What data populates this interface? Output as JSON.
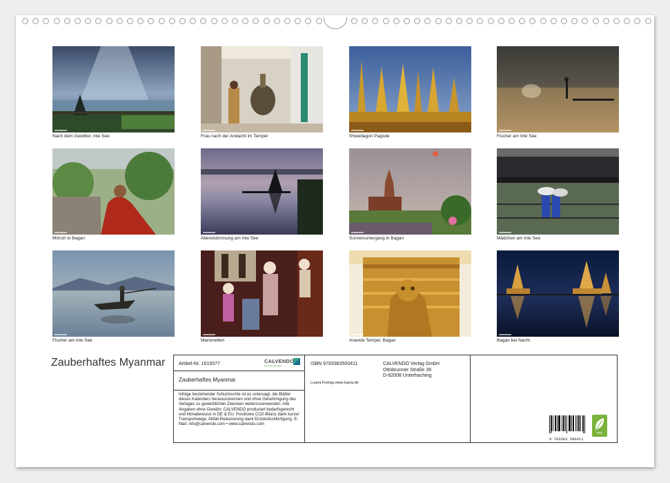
{
  "photos": [
    {
      "caption": "Nach dem Gewitter, Inle See"
    },
    {
      "caption": "Frau nach der Andacht im Tempel"
    },
    {
      "caption": "Shwedagon Pagode"
    },
    {
      "caption": "Fischer am Inle See"
    },
    {
      "caption": "Mönch in Bagan"
    },
    {
      "caption": "Abendstimmung am Inle See"
    },
    {
      "caption": "Sonnenuntergang in Bagan"
    },
    {
      "caption": "Mädchen am Inle See"
    },
    {
      "caption": "Fischer am Inle See"
    },
    {
      "caption": "Marionetten"
    },
    {
      "caption": "Ananda Tempel, Bagan"
    },
    {
      "caption": "Bagan bei Nacht"
    }
  ],
  "title": "Zauberhaftes Myanmar",
  "info": {
    "article_no": "Artikel-Nr. 1615577",
    "logo": "CALVENDO",
    "logo_sub": "Die Kalendermarke",
    "box_title": "Zauberhaftes Myanmar",
    "legal_text": "Infolge bestehender Schutzrechte ist es untersagt, die Blätter dieses Kalenders herauszutrennen und ohne Genehmigung des Verlages zu gewerblichen Zwecken weiterzuverwenden. Alle Angaben ohne Gewähr. CALVENDO produziert bedarfsgerecht und klimabewusst in DE & EU. Positivere CO2-Bilanz dank kurzer Transportwege. Abfall-Reduzierung dank Einzelstückfertigung. E-Mail: info@calvendo.com • www.calvendo.com",
    "isbn": "ISBN 9783383500411",
    "author": "Luana Freitag www.luana.de",
    "publisher_name": "CALVENDO Verlag GmbH",
    "publisher_street": "Ottobrunner Straße 39",
    "publisher_city": "D-82008 Unterhaching",
    "barcode_number": "9 783383 500411",
    "eco_label": "eco"
  }
}
